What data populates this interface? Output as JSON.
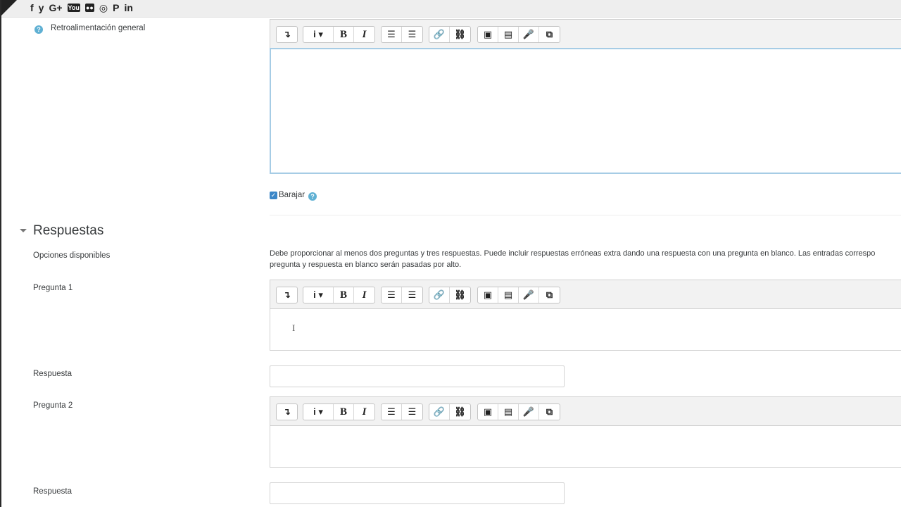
{
  "social": {
    "icons": [
      "facebook-icon",
      "twitter-icon",
      "google-plus-icon",
      "youtube-icon",
      "flickr-icon",
      "instagram-icon",
      "pinterest-icon",
      "linkedin-icon"
    ],
    "glyphs": [
      "f",
      "y",
      "G+",
      "You",
      "●●",
      "◎",
      "P",
      "in"
    ]
  },
  "fields": {
    "general_feedback_label": "Retroalimentación general",
    "shuffle_label": "Barajar",
    "help_glyph": "?"
  },
  "toolbar": {
    "show_more": "↴",
    "info": "i ▾",
    "bold": "B",
    "italic": "I",
    "unordered_list": "☰",
    "ordered_list": "☰",
    "link": "🔗",
    "unlink": "⛓",
    "image": "▣",
    "media": "▤",
    "record_audio": "🎤",
    "manage_files": "⧉"
  },
  "answers": {
    "section_title": "Respuestas",
    "available_options_label": "Opciones disponibles",
    "description_line1": "Debe proporcionar al menos dos preguntas y tres respuestas. Puede incluir respuestas erróneas extra dando una respuesta con una pregunta en blanco. Las entradas correspo",
    "description_line2": "pregunta y respuesta en blanco serán pasadas por alto.",
    "question1_label": "Pregunta 1",
    "answer1_label": "Respuesta",
    "question2_label": "Pregunta 2",
    "answer2_label": "Respuesta"
  },
  "colors": {
    "accent": "#3b87c8",
    "help": "#5fb0d3",
    "focus_border": "#a6cce5"
  }
}
